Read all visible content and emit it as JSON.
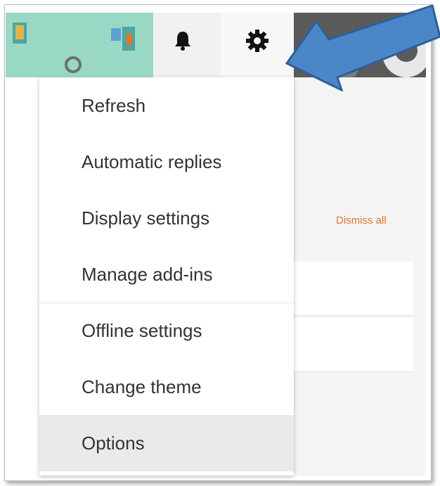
{
  "header": {
    "icons": [
      "theme-banner",
      "bell-icon",
      "gear-icon",
      "avatar"
    ],
    "theme_color": "#9ad8c6"
  },
  "settings_menu": {
    "items": [
      {
        "label": "Refresh"
      },
      {
        "label": "Automatic replies"
      },
      {
        "label": "Display settings"
      },
      {
        "label": "Manage add-ins"
      },
      {
        "label": "Offline settings"
      },
      {
        "label": "Change theme"
      },
      {
        "label": "Options"
      }
    ],
    "selected": "Options"
  },
  "notifications": {
    "dismiss_label": "Dismiss all",
    "dismiss_color": "#e0762d"
  },
  "annotation": {
    "arrow_color": "#4a86c8",
    "arrow_target": "gear-icon"
  }
}
